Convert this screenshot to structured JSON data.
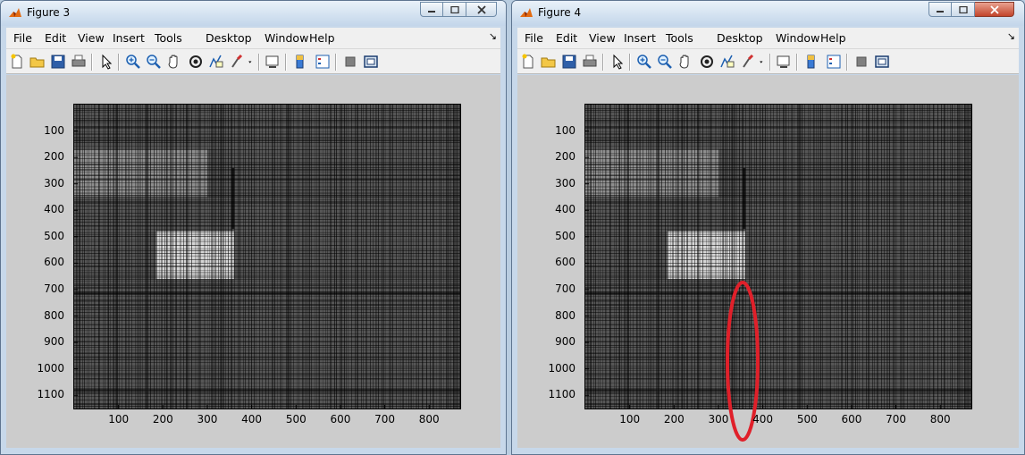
{
  "windows": [
    {
      "id": "w3",
      "title": "Figure 3",
      "active": false,
      "highlight": false
    },
    {
      "id": "w4",
      "title": "Figure 4",
      "active": true,
      "highlight": true
    }
  ],
  "menu": [
    "File",
    "Edit",
    "View",
    "Insert",
    "Tools",
    "Desktop",
    "Window",
    "Help"
  ],
  "toolbar_icons": [
    "new-figure-icon",
    "open-file-icon",
    "save-icon",
    "print-icon",
    "pointer-icon",
    "zoom-in-icon",
    "zoom-out-icon",
    "pan-hand-icon",
    "rotate-3d-icon",
    "data-cursor-icon",
    "brush-icon",
    "brush-dropdown-icon",
    "link-plot-icon",
    "colorbar-icon",
    "legend-icon",
    "hide-plot-tools-icon",
    "show-plot-tools-icon"
  ],
  "plot": {
    "y_ticks": [
      "100",
      "200",
      "300",
      "400",
      "500",
      "600",
      "700",
      "800",
      "900",
      "1000",
      "1100"
    ],
    "x_ticks": [
      "100",
      "200",
      "300",
      "400",
      "500",
      "600",
      "700",
      "800"
    ],
    "xlim": [
      0,
      870
    ],
    "ylim": [
      0,
      1150
    ]
  },
  "colors": {
    "highlight": "#e0202a",
    "figure_bg": "#cccccc",
    "close_active": "#c2452b"
  }
}
